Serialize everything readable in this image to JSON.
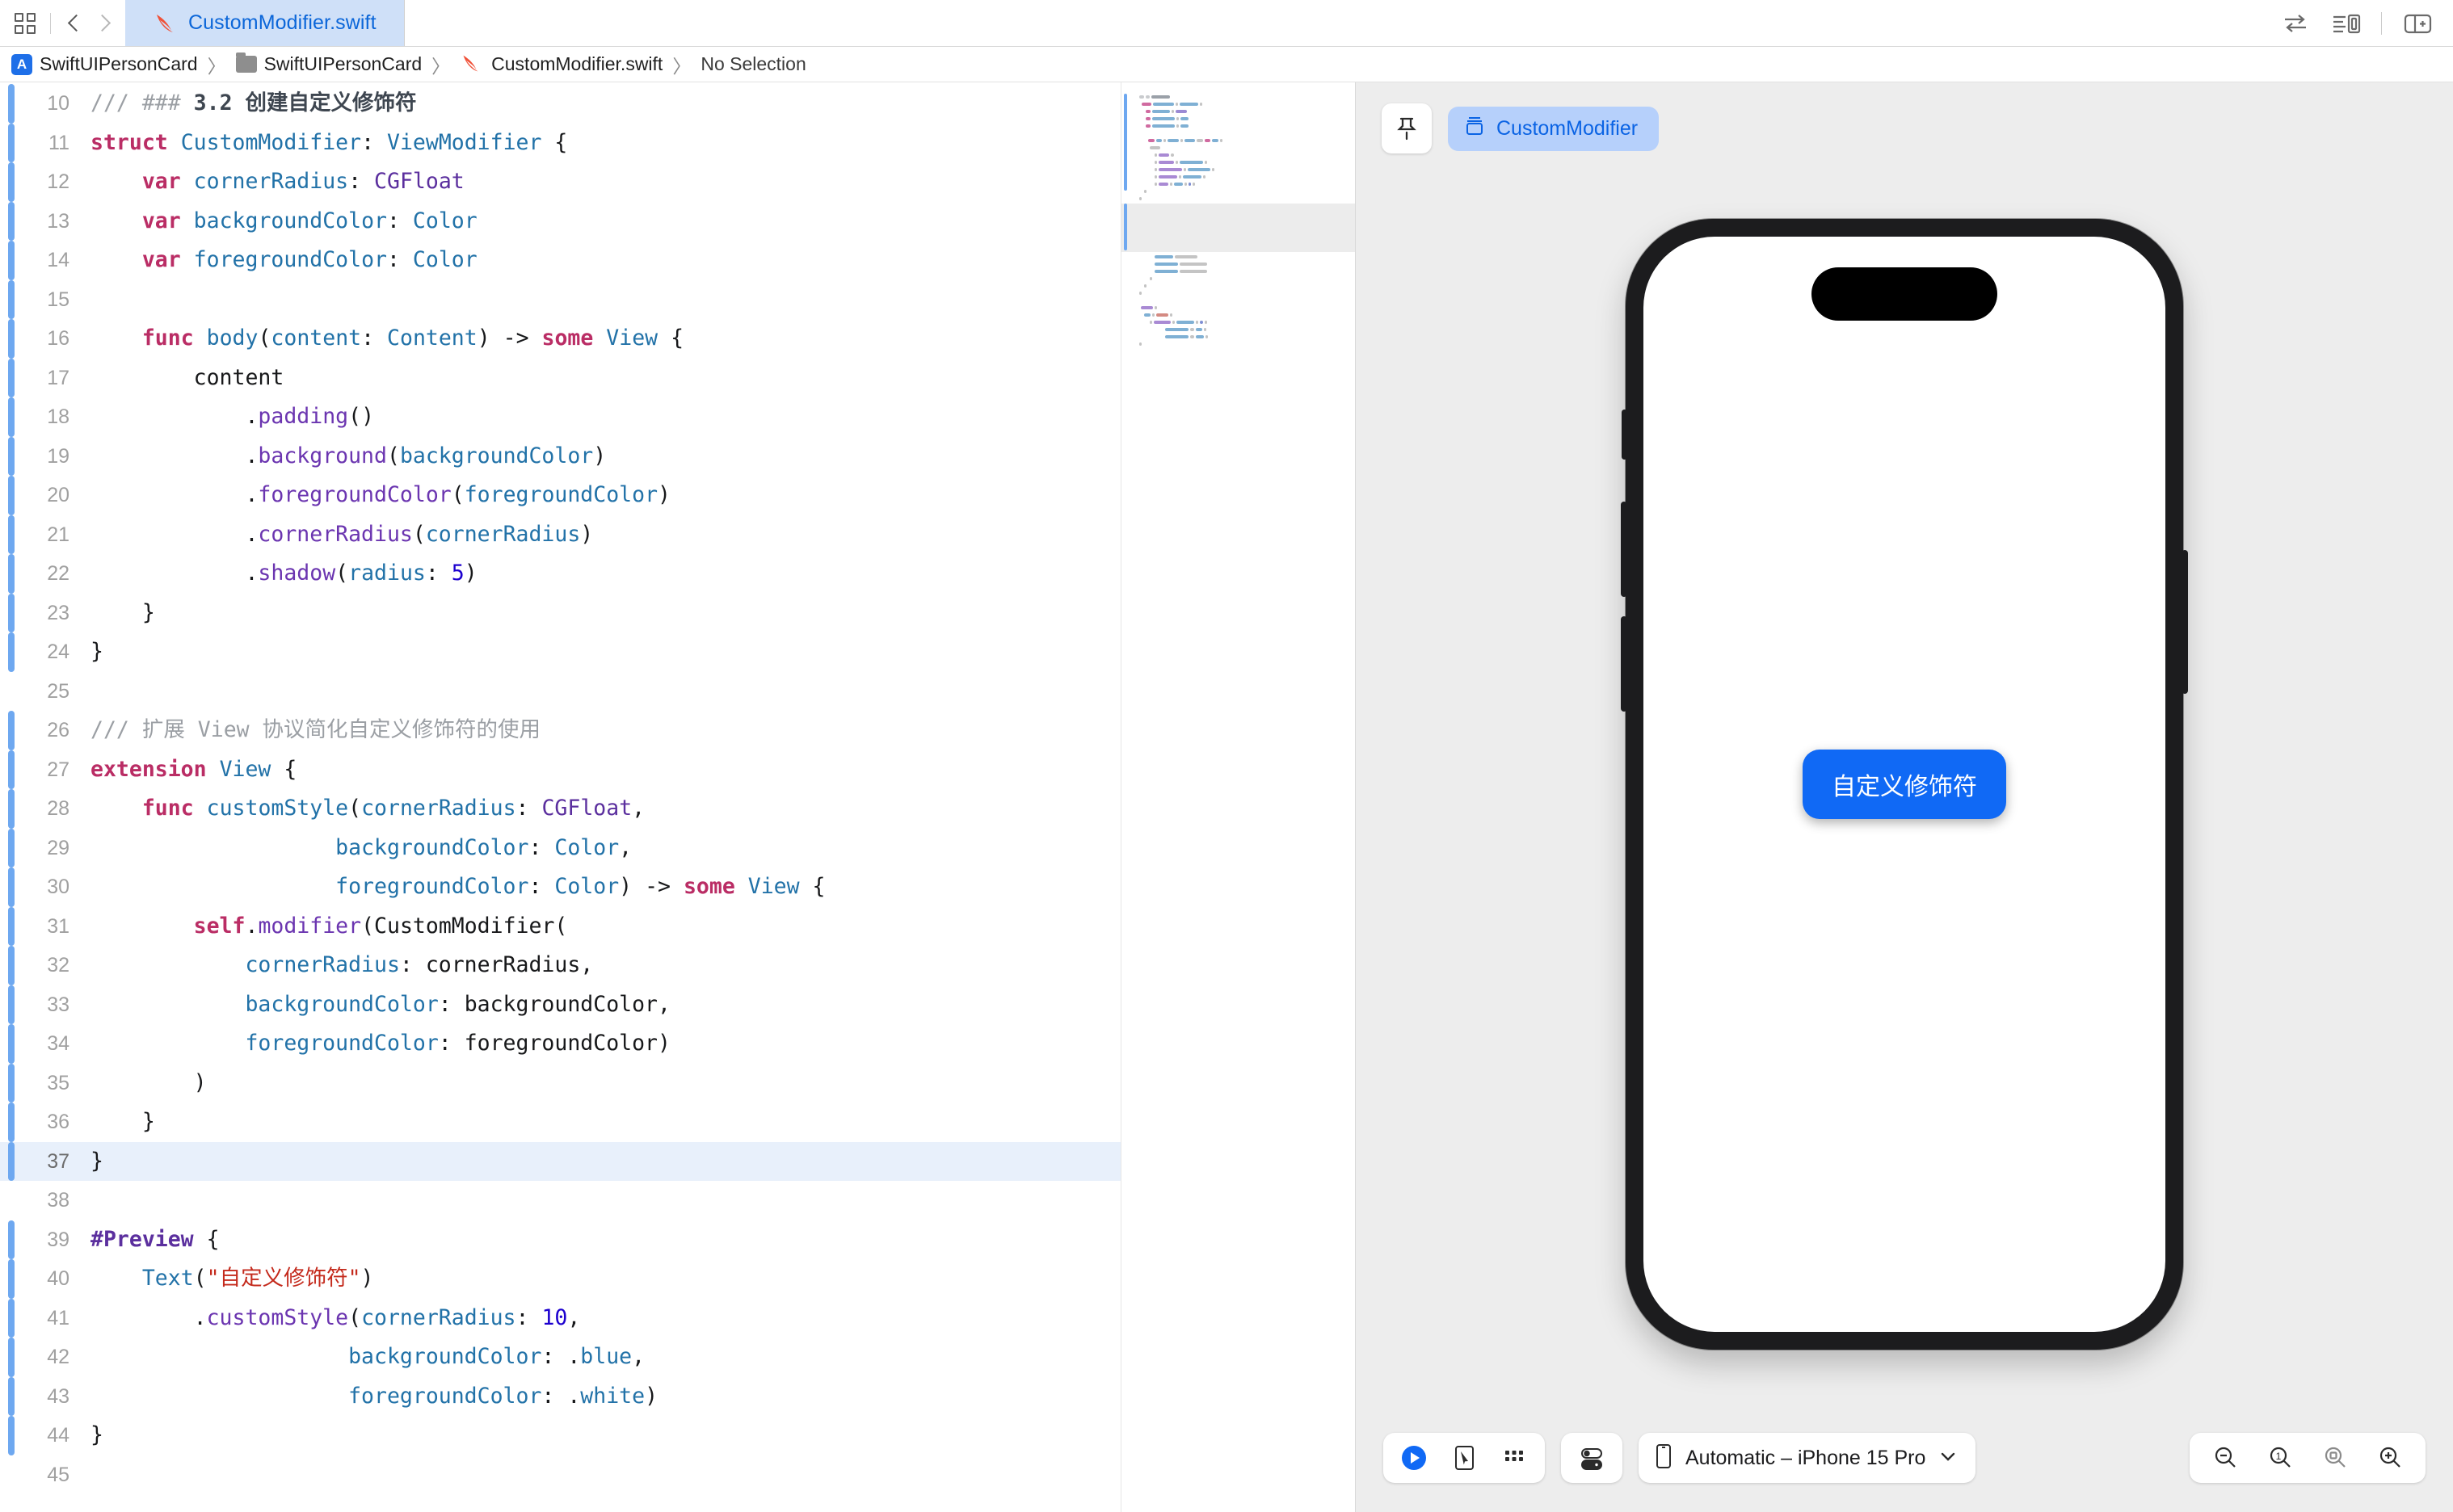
{
  "window": {
    "tab": {
      "label": "CustomModifier.swift",
      "icon": "swift-icon"
    },
    "nav_back_icon": "chevron-left-icon",
    "nav_forward_icon": "chevron-right-icon",
    "grid_icon": "navigator-grid-icon",
    "right_icons": [
      "compare-arrows-icon",
      "inspector-list-icon",
      "add-editor-icon"
    ]
  },
  "breadcrumb": {
    "items": [
      {
        "label": "SwiftUIPersonCard",
        "icon": "xcode-project-icon"
      },
      {
        "label": "SwiftUIPersonCard",
        "icon": "folder-icon"
      },
      {
        "label": "CustomModifier.swift",
        "icon": "swift-icon"
      },
      {
        "label": "No Selection",
        "icon": ""
      }
    ],
    "separator": "〉"
  },
  "editor": {
    "highlighted_line": 37,
    "changed_lines": [
      10,
      11,
      12,
      13,
      14,
      15,
      16,
      17,
      18,
      19,
      20,
      21,
      22,
      23,
      24,
      26,
      27,
      28,
      29,
      30,
      31,
      32,
      33,
      34,
      35,
      36,
      37,
      39,
      40,
      41,
      42,
      43,
      44
    ],
    "lines": [
      {
        "n": 10,
        "tokens": [
          {
            "t": "/// ",
            "c": "cmt"
          },
          {
            "t": "### ",
            "c": "cmt"
          },
          {
            "t": "3.2 创建自定义修饰符",
            "c": "cmtb"
          }
        ]
      },
      {
        "n": 11,
        "tokens": [
          {
            "t": "struct",
            "c": "kw"
          },
          {
            "t": " ",
            "c": "plain"
          },
          {
            "t": "CustomModifier",
            "c": "ident"
          },
          {
            "t": ": ",
            "c": "plain"
          },
          {
            "t": "ViewModifier",
            "c": "ident"
          },
          {
            "t": " {",
            "c": "plain"
          }
        ]
      },
      {
        "n": 12,
        "tokens": [
          {
            "t": "    ",
            "c": "plain"
          },
          {
            "t": "var",
            "c": "kw"
          },
          {
            "t": " ",
            "c": "plain"
          },
          {
            "t": "cornerRadius",
            "c": "ident"
          },
          {
            "t": ": ",
            "c": "plain"
          },
          {
            "t": "CGFloat",
            "c": "typ"
          }
        ]
      },
      {
        "n": 13,
        "tokens": [
          {
            "t": "    ",
            "c": "plain"
          },
          {
            "t": "var",
            "c": "kw"
          },
          {
            "t": " ",
            "c": "plain"
          },
          {
            "t": "backgroundColor",
            "c": "ident"
          },
          {
            "t": ": ",
            "c": "plain"
          },
          {
            "t": "Color",
            "c": "ident"
          }
        ]
      },
      {
        "n": 14,
        "tokens": [
          {
            "t": "    ",
            "c": "plain"
          },
          {
            "t": "var",
            "c": "kw"
          },
          {
            "t": " ",
            "c": "plain"
          },
          {
            "t": "foregroundColor",
            "c": "ident"
          },
          {
            "t": ": ",
            "c": "plain"
          },
          {
            "t": "Color",
            "c": "ident"
          }
        ]
      },
      {
        "n": 15,
        "tokens": []
      },
      {
        "n": 16,
        "tokens": [
          {
            "t": "    ",
            "c": "plain"
          },
          {
            "t": "func",
            "c": "kw"
          },
          {
            "t": " ",
            "c": "plain"
          },
          {
            "t": "body",
            "c": "ident"
          },
          {
            "t": "(",
            "c": "plain"
          },
          {
            "t": "content",
            "c": "ident"
          },
          {
            "t": ": ",
            "c": "plain"
          },
          {
            "t": "Content",
            "c": "ident"
          },
          {
            "t": ") -> ",
            "c": "plain"
          },
          {
            "t": "some",
            "c": "kw"
          },
          {
            "t": " ",
            "c": "plain"
          },
          {
            "t": "View",
            "c": "ident"
          },
          {
            "t": " {",
            "c": "plain"
          }
        ]
      },
      {
        "n": 17,
        "tokens": [
          {
            "t": "        content",
            "c": "plain"
          }
        ]
      },
      {
        "n": 18,
        "tokens": [
          {
            "t": "            .",
            "c": "plain"
          },
          {
            "t": "padding",
            "c": "meth"
          },
          {
            "t": "()",
            "c": "plain"
          }
        ]
      },
      {
        "n": 19,
        "tokens": [
          {
            "t": "            .",
            "c": "plain"
          },
          {
            "t": "background",
            "c": "meth"
          },
          {
            "t": "(",
            "c": "plain"
          },
          {
            "t": "backgroundColor",
            "c": "ident"
          },
          {
            "t": ")",
            "c": "plain"
          }
        ]
      },
      {
        "n": 20,
        "tokens": [
          {
            "t": "            .",
            "c": "plain"
          },
          {
            "t": "foregroundColor",
            "c": "meth"
          },
          {
            "t": "(",
            "c": "plain"
          },
          {
            "t": "foregroundColor",
            "c": "ident"
          },
          {
            "t": ")",
            "c": "plain"
          }
        ]
      },
      {
        "n": 21,
        "tokens": [
          {
            "t": "            .",
            "c": "plain"
          },
          {
            "t": "cornerRadius",
            "c": "meth"
          },
          {
            "t": "(",
            "c": "plain"
          },
          {
            "t": "cornerRadius",
            "c": "ident"
          },
          {
            "t": ")",
            "c": "plain"
          }
        ]
      },
      {
        "n": 22,
        "tokens": [
          {
            "t": "            .",
            "c": "plain"
          },
          {
            "t": "shadow",
            "c": "meth"
          },
          {
            "t": "(",
            "c": "plain"
          },
          {
            "t": "radius",
            "c": "ident"
          },
          {
            "t": ": ",
            "c": "plain"
          },
          {
            "t": "5",
            "c": "num"
          },
          {
            "t": ")",
            "c": "plain"
          }
        ]
      },
      {
        "n": 23,
        "tokens": [
          {
            "t": "    }",
            "c": "plain"
          }
        ]
      },
      {
        "n": 24,
        "tokens": [
          {
            "t": "}",
            "c": "plain"
          }
        ]
      },
      {
        "n": 25,
        "tokens": []
      },
      {
        "n": 26,
        "tokens": [
          {
            "t": "/// ",
            "c": "cmt"
          },
          {
            "t": "扩展 View 协议简化自定义修饰符的使用",
            "c": "cmt"
          }
        ]
      },
      {
        "n": 27,
        "tokens": [
          {
            "t": "extension",
            "c": "kw"
          },
          {
            "t": " ",
            "c": "plain"
          },
          {
            "t": "View",
            "c": "ident"
          },
          {
            "t": " {",
            "c": "plain"
          }
        ]
      },
      {
        "n": 28,
        "tokens": [
          {
            "t": "    ",
            "c": "plain"
          },
          {
            "t": "func",
            "c": "kw"
          },
          {
            "t": " ",
            "c": "plain"
          },
          {
            "t": "customStyle",
            "c": "ident"
          },
          {
            "t": "(",
            "c": "plain"
          },
          {
            "t": "cornerRadius",
            "c": "ident"
          },
          {
            "t": ": ",
            "c": "plain"
          },
          {
            "t": "CGFloat",
            "c": "typ"
          },
          {
            "t": ",",
            "c": "plain"
          }
        ]
      },
      {
        "n": 29,
        "tokens": [
          {
            "t": "                   ",
            "c": "plain"
          },
          {
            "t": "backgroundColor",
            "c": "ident"
          },
          {
            "t": ": ",
            "c": "plain"
          },
          {
            "t": "Color",
            "c": "ident"
          },
          {
            "t": ",",
            "c": "plain"
          }
        ]
      },
      {
        "n": 30,
        "tokens": [
          {
            "t": "                   ",
            "c": "plain"
          },
          {
            "t": "foregroundColor",
            "c": "ident"
          },
          {
            "t": ": ",
            "c": "plain"
          },
          {
            "t": "Color",
            "c": "ident"
          },
          {
            "t": ") -> ",
            "c": "plain"
          },
          {
            "t": "some",
            "c": "kw"
          },
          {
            "t": " ",
            "c": "plain"
          },
          {
            "t": "View",
            "c": "ident"
          },
          {
            "t": " {",
            "c": "plain"
          }
        ]
      },
      {
        "n": 31,
        "tokens": [
          {
            "t": "        ",
            "c": "plain"
          },
          {
            "t": "self",
            "c": "kw"
          },
          {
            "t": ".",
            "c": "plain"
          },
          {
            "t": "modifier",
            "c": "meth"
          },
          {
            "t": "(",
            "c": "plain"
          },
          {
            "t": "CustomModifier",
            "c": "plain"
          },
          {
            "t": "(",
            "c": "plain"
          }
        ]
      },
      {
        "n": 32,
        "tokens": [
          {
            "t": "            ",
            "c": "plain"
          },
          {
            "t": "cornerRadius",
            "c": "ident"
          },
          {
            "t": ": cornerRadius,",
            "c": "plain"
          }
        ]
      },
      {
        "n": 33,
        "tokens": [
          {
            "t": "            ",
            "c": "plain"
          },
          {
            "t": "backgroundColor",
            "c": "ident"
          },
          {
            "t": ": backgroundColor,",
            "c": "plain"
          }
        ]
      },
      {
        "n": 34,
        "tokens": [
          {
            "t": "            ",
            "c": "plain"
          },
          {
            "t": "foregroundColor",
            "c": "ident"
          },
          {
            "t": ": foregroundColor)",
            "c": "plain"
          }
        ]
      },
      {
        "n": 35,
        "tokens": [
          {
            "t": "        )",
            "c": "plain"
          }
        ]
      },
      {
        "n": 36,
        "tokens": [
          {
            "t": "    }",
            "c": "plain"
          }
        ]
      },
      {
        "n": 37,
        "tokens": [
          {
            "t": "}",
            "c": "plain"
          }
        ]
      },
      {
        "n": 38,
        "tokens": []
      },
      {
        "n": 39,
        "tokens": [
          {
            "t": "#Preview",
            "c": "macro"
          },
          {
            "t": " {",
            "c": "plain"
          }
        ]
      },
      {
        "n": 40,
        "tokens": [
          {
            "t": "    ",
            "c": "plain"
          },
          {
            "t": "Text",
            "c": "ident"
          },
          {
            "t": "(",
            "c": "plain"
          },
          {
            "t": "\"自定义修饰符\"",
            "c": "str"
          },
          {
            "t": ")",
            "c": "plain"
          }
        ]
      },
      {
        "n": 41,
        "tokens": [
          {
            "t": "        .",
            "c": "plain"
          },
          {
            "t": "customStyle",
            "c": "meth"
          },
          {
            "t": "(",
            "c": "plain"
          },
          {
            "t": "cornerRadius",
            "c": "ident"
          },
          {
            "t": ": ",
            "c": "plain"
          },
          {
            "t": "10",
            "c": "num"
          },
          {
            "t": ",",
            "c": "plain"
          }
        ]
      },
      {
        "n": 42,
        "tokens": [
          {
            "t": "                    ",
            "c": "plain"
          },
          {
            "t": "backgroundColor",
            "c": "ident"
          },
          {
            "t": ": .",
            "c": "plain"
          },
          {
            "t": "blue",
            "c": "ident"
          },
          {
            "t": ",",
            "c": "plain"
          }
        ]
      },
      {
        "n": 43,
        "tokens": [
          {
            "t": "                    ",
            "c": "plain"
          },
          {
            "t": "foregroundColor",
            "c": "ident"
          },
          {
            "t": ": .",
            "c": "plain"
          },
          {
            "t": "white",
            "c": "ident"
          },
          {
            "t": ")",
            "c": "plain"
          }
        ]
      },
      {
        "n": 44,
        "tokens": [
          {
            "t": "}",
            "c": "plain"
          }
        ]
      },
      {
        "n": 45,
        "tokens": []
      }
    ]
  },
  "preview": {
    "pin_icon": "pin-icon",
    "chip": {
      "label": "CustomModifier",
      "icon": "preview-box-icon"
    },
    "device": {
      "label": "Automatic – iPhone 15 Pro",
      "icon": "iphone-icon",
      "chevron": "chevron-down-icon"
    },
    "canvas_button_label": "自定义修饰符",
    "controls": [
      "play-icon",
      "select-pointer-icon",
      "variants-grid-icon"
    ],
    "inspector_icon": "device-settings-icon",
    "zoom_controls": [
      "zoom-out-icon",
      "zoom-actual-icon",
      "zoom-fit-icon",
      "zoom-in-icon"
    ],
    "zoom_actual_label": "1"
  },
  "colors": {
    "accent_blue": "#0a63e4",
    "tab_active_bg": "#cfe0f8",
    "chip_bg": "#b6d0fb",
    "preview_button_bg": "#1069f5",
    "change_bar": "#6ea8f0",
    "highlight_row": "#e8f0fb"
  }
}
